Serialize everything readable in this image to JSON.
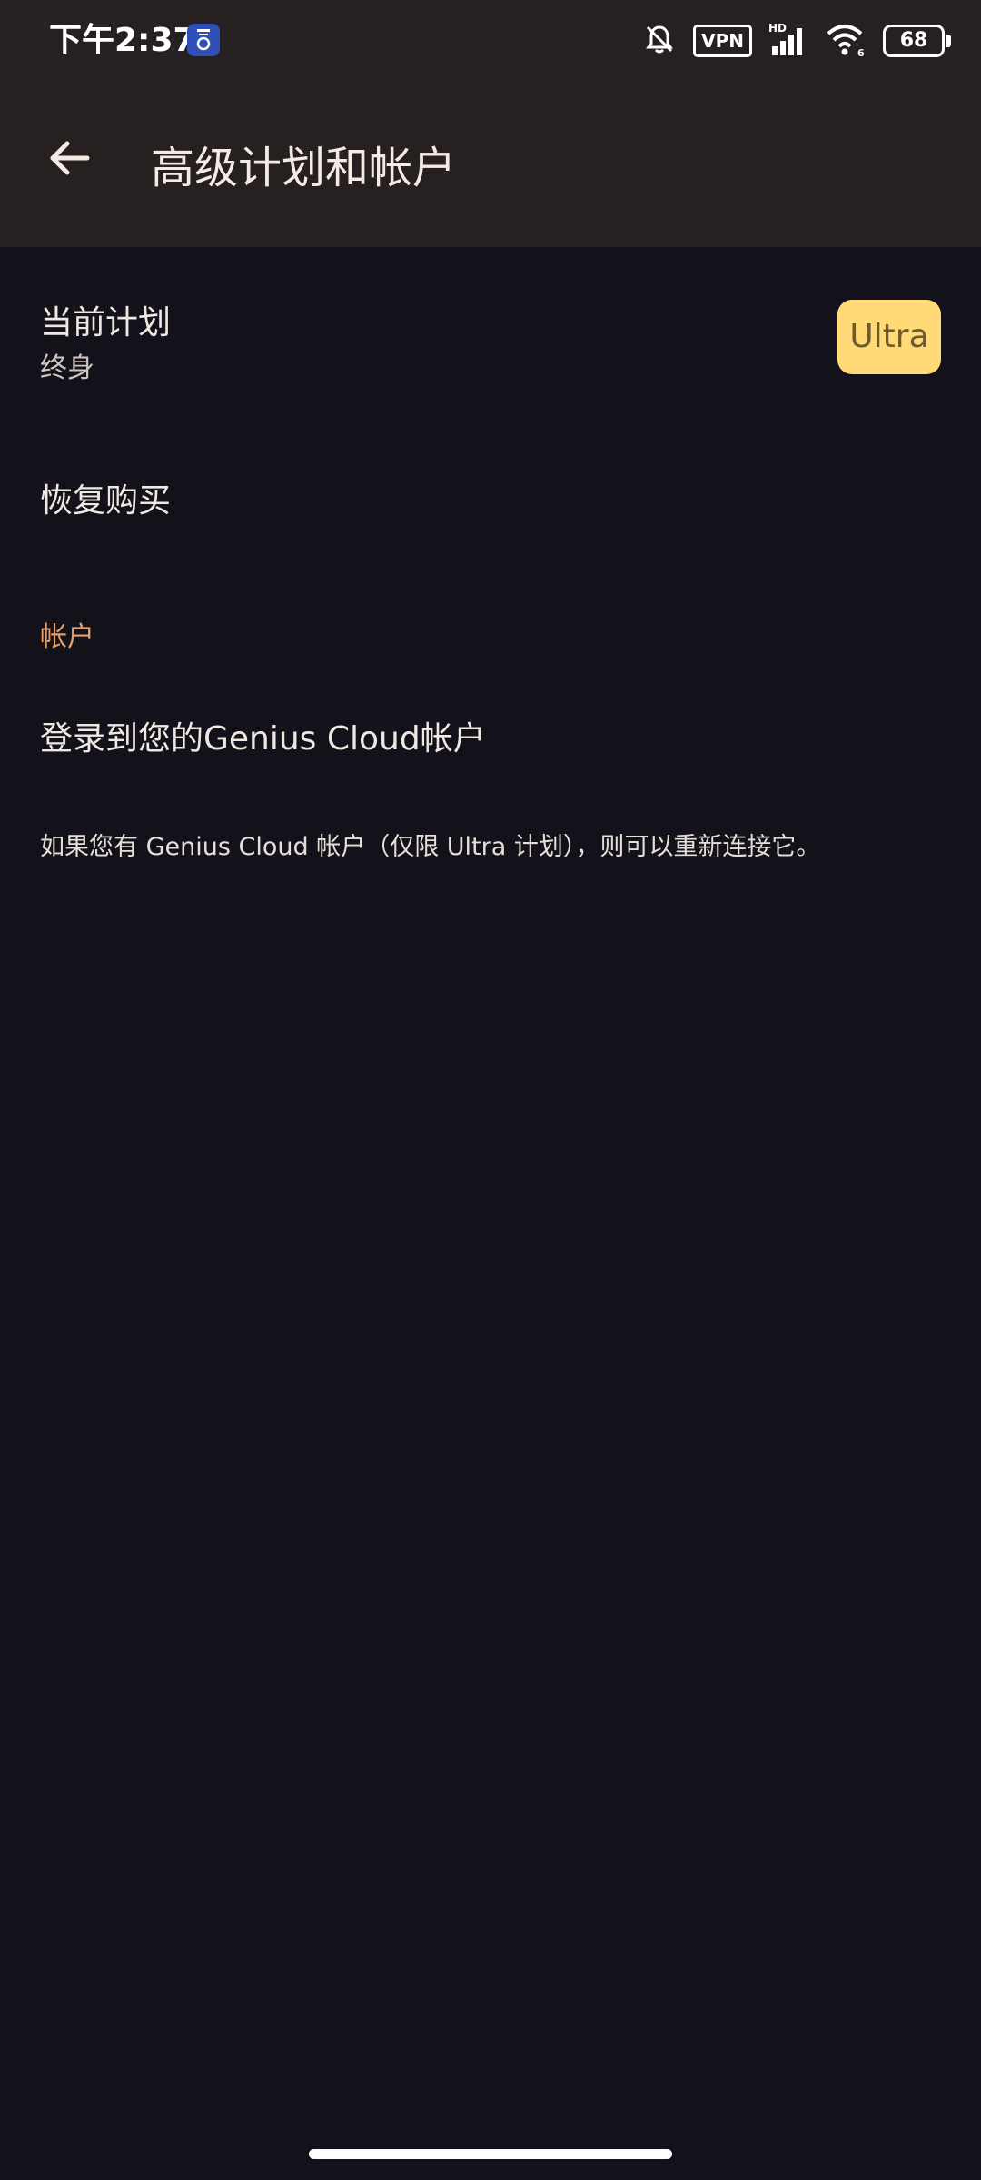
{
  "status_bar": {
    "time": "下午2:37",
    "vpn_label": "VPN",
    "hd_label": "HD",
    "wifi_label": "6",
    "battery_level": "68",
    "icons": [
      "app-notification-icon",
      "bell-off-icon",
      "vpn-icon",
      "signal-icon",
      "wifi-icon",
      "battery-icon"
    ]
  },
  "app_bar": {
    "back_icon": "arrow-left-icon",
    "title": "高级计划和帐户"
  },
  "plan": {
    "title": "当前计划",
    "subtitle": "终身",
    "badge": "Ultra"
  },
  "restore": {
    "label": "恢复购买"
  },
  "account_section": {
    "header": "帐户",
    "login_label": "登录到您的Genius Cloud帐户",
    "note": "如果您有 Genius Cloud 帐户（仅限 Ultra 计划），则可以重新连接它。"
  },
  "colors": {
    "background": "#13111a",
    "topbar": "#262120",
    "accent": "#e5a06b",
    "badge_bg": "#ffda76",
    "badge_text": "#6b5a34"
  }
}
